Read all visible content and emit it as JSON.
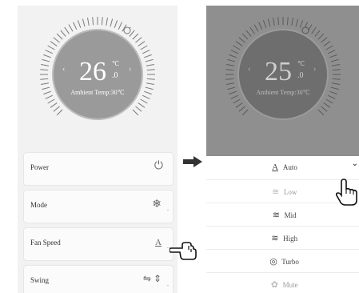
{
  "left_screen": {
    "temperature": "26",
    "unit": "℃",
    "decimal": ".0",
    "ambient": "Ambient Temp:30℃",
    "prev_arrow": "‹",
    "next_arrow": "›",
    "controls": [
      {
        "label": "Power",
        "icon": "power-icon",
        "glyph": "⏻"
      },
      {
        "label": "Mode",
        "icon": "snowflake-icon",
        "glyph": "❄"
      },
      {
        "label": "Fan Speed",
        "icon": "fan-auto-icon",
        "glyph": "A"
      },
      {
        "label": "Swing",
        "icon": "swing-icon",
        "glyph": "⇋ ⇕"
      }
    ],
    "dot": "."
  },
  "right_screen": {
    "temperature": "25",
    "unit": "℃",
    "decimal": ".0",
    "ambient": "Ambient Temp:30℃",
    "prev_arrow": "‹",
    "next_arrow": "›",
    "fan_options": [
      {
        "label": "Auto",
        "icon": "auto-icon",
        "glyph": "A",
        "selected": true
      },
      {
        "label": "Low",
        "icon": "low-icon",
        "glyph": "≋",
        "selected": false
      },
      {
        "label": "Mid",
        "icon": "mid-icon",
        "glyph": "≋",
        "selected": false
      },
      {
        "label": "High",
        "icon": "high-icon",
        "glyph": "≋",
        "selected": false
      },
      {
        "label": "Turbo",
        "icon": "turbo-icon",
        "glyph": "◎",
        "selected": false
      },
      {
        "label": "Mute",
        "icon": "mute-icon",
        "glyph": "✿",
        "selected": false
      }
    ],
    "chevron": "⌄"
  },
  "transition_arrow": "➡",
  "colors": {
    "dial_left": "#9a9a9a",
    "dial_right": "#6e6e6e",
    "overlay": "#8f8f8f"
  }
}
